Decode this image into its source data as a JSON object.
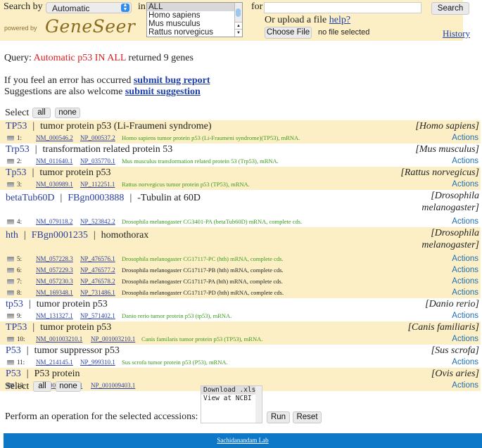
{
  "header": {
    "search_by_label": "Search by",
    "search_by_value": "Automatic",
    "powered_by": "powered by",
    "logo": "GeneSeer",
    "in_label": "in",
    "species_options": [
      "ALL",
      "Homo sapiens",
      "Mus musculus",
      "Rattus norvegicus"
    ],
    "species_selected": "ALL",
    "for_label": "for",
    "for_value": "",
    "search_button": "Search",
    "upload_text": "Or upload a file",
    "help_link": "help?",
    "choose_file_button": "Choose File",
    "no_file_text": "no file selected",
    "history_link": "History"
  },
  "query": {
    "prefix": "Query:",
    "highlight": "Automatic p53 IN ALL",
    "suffix": "returned 9 genes",
    "highlight_color": "#d42020"
  },
  "feedback": {
    "line1_text": "If you feel an error has occurred",
    "line1_link": "submit bug report",
    "line2_text": "Suggestions are also welcome",
    "line2_link": "submit suggestion"
  },
  "select": {
    "label": "Select",
    "all": "all",
    "none": "none"
  },
  "genes": [
    {
      "symbol": "TP53",
      "name": "tumor protein p53 (Li-Fraumeni syndrome)",
      "species": "Homo sapiens",
      "accessions": [
        {
          "n": "1:",
          "nm": "NM_000546.2",
          "np": "NP_000537.2",
          "desc": "Homo sapiens tumor protein p53 (Li-Fraumeni syndrome)(TP53), mRNA.",
          "green": true,
          "action": "Actions"
        }
      ]
    },
    {
      "symbol": "Trp53",
      "name": "transformation related protein 53",
      "species": "Mus musculus",
      "accessions": [
        {
          "n": "2:",
          "nm": "NM_011640.1",
          "np": "NP_035770.1",
          "desc": "Mus musculus transformation related protein 53 (Trp53), mRNA.",
          "green": true,
          "action": "Actions"
        }
      ]
    },
    {
      "symbol": "Tp53",
      "name": "tumor protein p53",
      "species": "Rattus norvegicus",
      "accessions": [
        {
          "n": "3:",
          "nm": "NM_030989.1",
          "np": "NP_112251.1",
          "desc": "Rattus norvegicus tumor protein p53 (TP53), mRNA.",
          "green": true,
          "action": "Actions"
        }
      ]
    },
    {
      "symbol": "betaTub60D",
      "flybase": "FBgn0003888",
      "name": "-Tubulin at 60D",
      "species_line1": "Drosophila",
      "species_line2": "melanogaster",
      "accessions": [
        {
          "n": "4:",
          "nm": "NM_079118.2",
          "np": "NP_523842.2",
          "desc": "Drosophila melanogaster CG3401-PA (betaTub60D) mRNA, complete cds.",
          "green": true,
          "action": "Actions"
        }
      ]
    },
    {
      "symbol": "hth",
      "flybase": "FBgn0001235",
      "name": "homothorax",
      "species_line1": "Drosophila",
      "species_line2": "melanogaster",
      "accessions": [
        {
          "n": "5:",
          "nm": "NM_057228.3",
          "np": "NP_476576.1",
          "desc": "Drosophila melanogaster CG17117-PC (hth) mRNA, complete cds.",
          "green": true,
          "action": "Actions"
        },
        {
          "n": "6:",
          "nm": "NM_057229.3",
          "np": "NP_476577.2",
          "desc": "Drosophila melanogaster CG17117-PB (hth) mRNA, complete cds.",
          "green": false,
          "action": "Actions"
        },
        {
          "n": "7:",
          "nm": "NM_057230.3",
          "np": "NP_476578.2",
          "desc": "Drosophila melanogaster CG17117-PA (hth) mRNA, complete cds.",
          "green": false,
          "action": "Actions"
        },
        {
          "n": "8:",
          "nm": "NM_169348.1",
          "np": "NP_731486.1",
          "desc": "Drosophila melanogaster CG17117-PD (hth) mRNA, complete cds.",
          "green": false,
          "action": "Actions"
        }
      ]
    },
    {
      "symbol": "tp53",
      "name": "tumor protein p53",
      "species": "Danio rerio",
      "accessions": [
        {
          "n": "9:",
          "nm": "NM_131327.1",
          "np": "NP_571402.1",
          "desc": "Danio rerio tumor protein p53 (tp53), mRNA.",
          "green": true,
          "action": "Actions"
        }
      ]
    },
    {
      "symbol": "TP53",
      "name": "tumor protein p53",
      "species": "Canis familiaris",
      "accessions": [
        {
          "n": "10:",
          "nm": "NM_001003210.1",
          "np": "NP_001003210.1",
          "desc": "Canis familaris tumor protein p53 (TP53), mRNA.",
          "green": true,
          "action": "Actions"
        }
      ]
    },
    {
      "symbol": "P53",
      "name": "tumor suppressor p53",
      "species": "Sus scrofa",
      "accessions": [
        {
          "n": "11:",
          "nm": "NM_214145.1",
          "np": "NP_999310.1",
          "desc": "Sus scrofa tumor protein p53 (P53), mRNA.",
          "green": true,
          "action": "Actions"
        }
      ]
    },
    {
      "symbol": "P53",
      "name": "P53 protein",
      "species": "Ovis aries",
      "accessions": [
        {
          "n": "12:",
          "nm": "NM_001009403.1",
          "np": "NP_001009403.1",
          "desc": "",
          "green": true,
          "action": "Actions"
        }
      ]
    }
  ],
  "operations": {
    "options": [
      "Download .xls",
      "View at NCBI"
    ],
    "selected": "Download .xls",
    "label": "Perform an operation for the selected accessions:",
    "run_button": "Run",
    "reset_button": "Reset"
  },
  "footer": {
    "link": "Sachidanandam Lab",
    "color": "#0d78c8"
  }
}
